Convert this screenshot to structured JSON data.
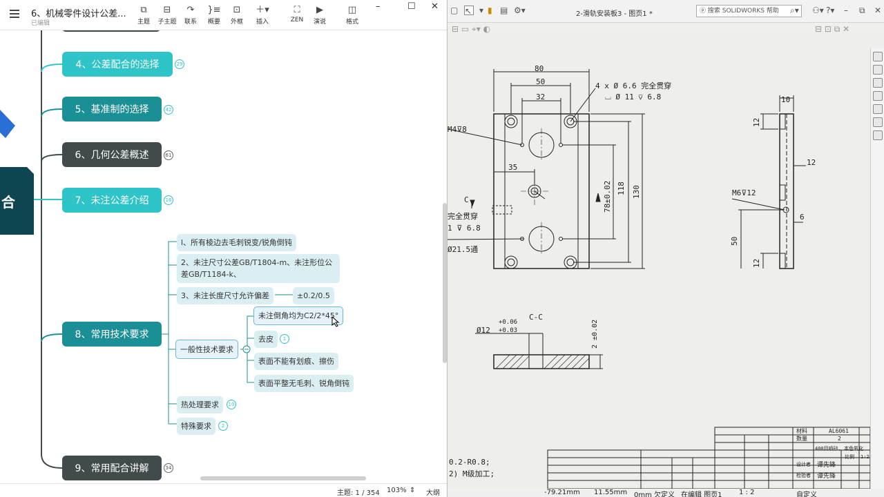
{
  "xmind": {
    "doc_title": "6、机械零件设计公差...",
    "doc_status": "已编辑",
    "toolbar": [
      "主题",
      "子主题",
      "联系",
      "概要",
      "外框",
      "插入",
      "ZEN",
      "演说",
      "格式"
    ],
    "toolbar_icons": [
      "topic-icon",
      "subtopic-icon",
      "relationship-icon",
      "summary-icon",
      "boundary-icon",
      "insert-icon",
      "zen-icon",
      "pitch-icon",
      "format-icon"
    ],
    "center_label": "合",
    "topics": [
      {
        "label": "4、公差配合的选择",
        "count": "29"
      },
      {
        "label": "5、基准制的选择",
        "count": "42"
      },
      {
        "label": "6、几何公差概述",
        "count": "61"
      },
      {
        "label": "7、未注公差介绍",
        "count": "16"
      },
      {
        "label": "8、常用技术要求",
        "count": ""
      },
      {
        "label": "9、常用配合讲解",
        "count": "34"
      }
    ],
    "subtopics": {
      "s1": "l、所有棱边去毛刺锐变/锐角倒钝",
      "s2": "2、未注尺寸公差GB/T1804-m、未注形位公差GB/T1184-k、",
      "s3": "3、未注长度尺寸允许偏差",
      "s3v": "±0.2/0.5",
      "general": "一般性技术要求",
      "g1": "未注倒角均为C2/2*45°",
      "g2": "去皮",
      "g2count": "1",
      "g3": "表面不能有划痕、擦伤",
      "g4": "表面平整无毛刺、锐角倒钝",
      "heat": "热处理要求",
      "heatcount": "10",
      "special": "特殊要求",
      "specialcount": "2"
    },
    "status": {
      "topic": "主题: 1 / 354",
      "zoom": "103%",
      "outline": "大纲"
    }
  },
  "solidworks": {
    "title": "2-滑轨安装板3 - 图页1 *",
    "search": "搜索 SOLIDWORKS 帮助",
    "status": {
      "x": "-79.21mm",
      "y": "11.55mm",
      "z": "0mm 欠定义",
      "edit": "在编辑 图页1",
      "scale": "1 : 2",
      "custom": "自定义"
    }
  },
  "drawing": {
    "dims": [
      "80",
      "50",
      "32",
      "35",
      "118",
      "130",
      "78±0.02",
      "10",
      "12",
      "12",
      "6",
      "50",
      "12",
      "2 ±0.02"
    ],
    "hole_note_1": "4 x Ø 6.6 完全贯穿",
    "hole_note_2": "⌴ Ø 11 ⊽ 6.8",
    "m4": "M4⊽8",
    "m6": "M6⊽12",
    "c_label": "C",
    "section": "C-C",
    "phi12": "Ø12",
    "tol_up": "+0.06",
    "tol_dn": "+0.03",
    "left_note1": "完全贯穿",
    "left_note2": "1 ⊽ 6.8",
    "left_note3": "Ø21.5通",
    "note1": "0.2-R0.8;",
    "note2": "2) M级加工;",
    "tb_material_label": "材料",
    "tb_material": "AL6061",
    "tb_qty_label": "数量",
    "tb_qty": "2",
    "tb_finish": "400目喷砂, 本色氧化",
    "tb_scale_label": "比例",
    "tb_scale": "1:2",
    "tb_designer": "谭先锋",
    "tb_checker": "谭先锋",
    "tb_design_label": "设计者",
    "tb_check_label": "检验者"
  }
}
